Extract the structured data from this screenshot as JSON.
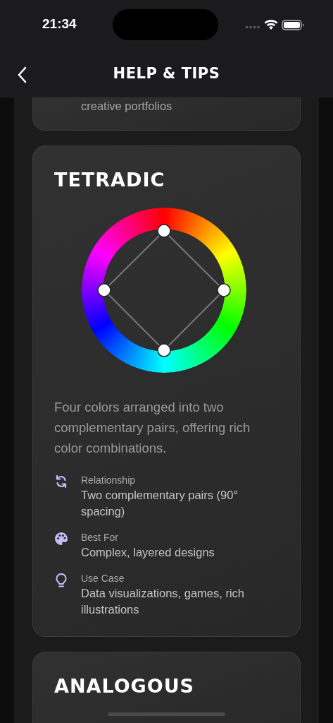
{
  "status_bar": {
    "time": "21:34"
  },
  "nav": {
    "title": "HELP & TIPS"
  },
  "cards": [
    {
      "kind": "partial",
      "lines": [
        "creative portfolios"
      ]
    },
    {
      "kind": "full",
      "title": "TETRADIC",
      "description": "Four colors arranged into two complementary pairs, offering rich color combinations.",
      "details": [
        {
          "kind": "cycle",
          "label": "Relationship",
          "value": "Two complementary pairs (90° spacing)"
        },
        {
          "kind": "palette",
          "label": "Best For",
          "value": "Complex, layered designs"
        },
        {
          "kind": "bulb",
          "label": "Use Case",
          "value": "Data visualizations, games, rich illustrations"
        }
      ]
    },
    {
      "kind": "title_only",
      "title": "ANALOGOUS"
    }
  ]
}
